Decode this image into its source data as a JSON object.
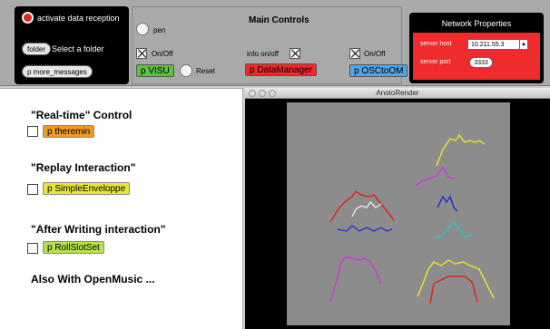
{
  "top_left": {
    "activate_label": "activate data reception",
    "folder_button": "folder",
    "select_folder_label": "Select a folder",
    "more_messages_button": "p more_messages"
  },
  "main_controls": {
    "title": "Main Controls",
    "pen_label": "pen",
    "onoff_label_1": "On/Off",
    "info_onoff_label": "info on/off",
    "onoff_label_2": "On/Off",
    "visu_object": "p VISU",
    "reset_label": "Reset",
    "datamanager_object": "p DataManager",
    "osctoom_object": "p OSCtoOM"
  },
  "network": {
    "title": "Network Properties",
    "server_host_label": "server host",
    "server_host_value": "10.211.55.3",
    "server_port_label": "server port",
    "server_port_value": "3333"
  },
  "left_panel": {
    "realtime_heading": "\"Real-time\" Control",
    "theremin_object": "p theremin",
    "replay_heading": "\"Replay Interaction\"",
    "simpleenveloppe_object": "p SimpleEnveloppe",
    "after_writing_heading": "\"After Writing interaction\"",
    "rollslotset_object": "p RollSlotSet",
    "also_label": "Also With OpenMusic ..."
  },
  "render_window": {
    "title": "AnotoRender"
  },
  "colors": {
    "red_button": "#e0241f",
    "visu": "#5ec13a",
    "datamanager": "#ee2a2a",
    "osctoom": "#4fa6e8",
    "theremin": "#f39a22",
    "simpleenveloppe": "#e8e43a",
    "rollslotset": "#b6e24c",
    "network_panel": "#ef2b2b",
    "canvas": "#8c8c8c"
  }
}
